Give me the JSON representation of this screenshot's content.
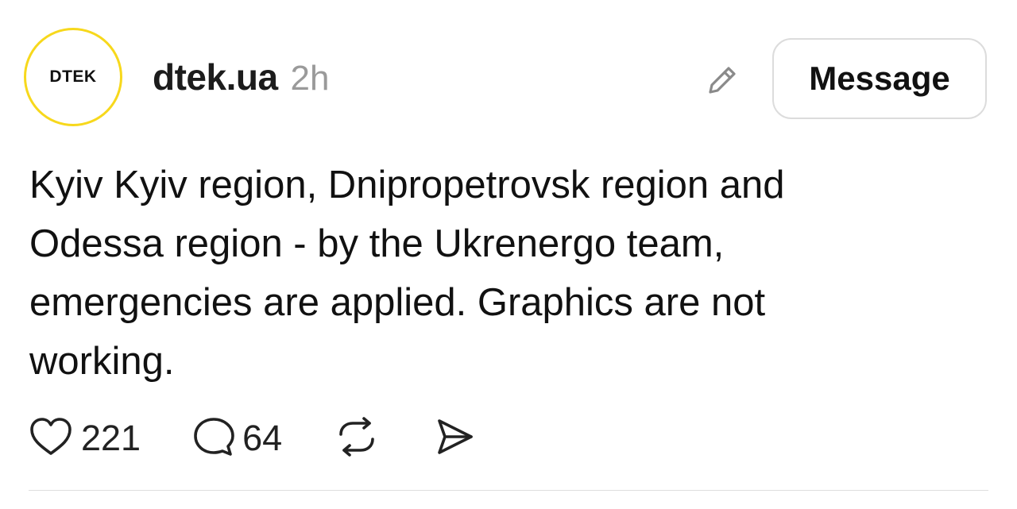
{
  "post": {
    "author": {
      "username": "dtek.ua",
      "avatar_logo_text": "DTEK",
      "avatar_ring_color": "#f7d81c"
    },
    "timestamp": "2h",
    "header_actions": {
      "edit_icon": "pencil-icon",
      "message_label": "Message"
    },
    "body_lines": [
      "Kyiv Kyiv region, Dnipropetrovsk region and",
      "Odessa region - by the Ukrenergo team,",
      "emergencies are applied. Graphics are not",
      "working."
    ],
    "actions": {
      "like": {
        "icon": "heart-icon",
        "count": "221"
      },
      "reply": {
        "icon": "comment-bubble-icon",
        "count": "64"
      },
      "repost": {
        "icon": "repost-icon"
      },
      "share": {
        "icon": "send-icon"
      }
    }
  }
}
